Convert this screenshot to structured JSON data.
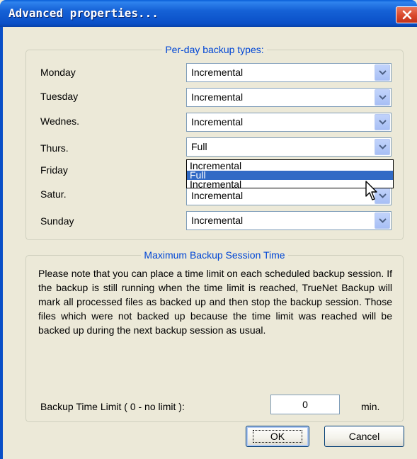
{
  "window": {
    "title": "Advanced properties..."
  },
  "colors": {
    "title_bar": "#0a4fc7",
    "legend_text": "#0046d5",
    "selection": "#316ac5",
    "close_button": "#d9482b"
  },
  "backup_types": {
    "legend": "Per-day backup types:",
    "days": [
      {
        "label": "Monday",
        "value": "Incremental"
      },
      {
        "label": "Tuesday",
        "value": "Incremental"
      },
      {
        "label": "Wednes.",
        "value": "Incremental"
      },
      {
        "label": "Thurs.",
        "value": "Full"
      },
      {
        "label": "Friday",
        "value": ""
      },
      {
        "label": "Satur.",
        "value": "Incremental"
      },
      {
        "label": "Sunday",
        "value": "Incremental"
      }
    ],
    "open_dropdown": {
      "for_day": "Thurs.",
      "options": [
        "Incremental",
        "Full",
        "Incremental"
      ],
      "highlighted": "Full"
    }
  },
  "session_time": {
    "legend": "Maximum Backup Session Time",
    "note": "Please note that you can place a time limit on each scheduled backup session. If the backup is still running when the time limit is reached, TrueNet Backup will mark all processed files as backed up and then stop the backup session. Those files which were not backed up because the time limit was reached will be backed up during the next backup session as usual.",
    "limit_label": "Backup Time Limit ( 0 - no limit ):",
    "limit_value": "0",
    "unit": "min."
  },
  "buttons": {
    "ok": "OK",
    "cancel": "Cancel"
  },
  "icons": {
    "close": "close-icon",
    "dropdown_arrow": "chevron-down-icon",
    "cursor": "mouse-pointer-icon"
  }
}
